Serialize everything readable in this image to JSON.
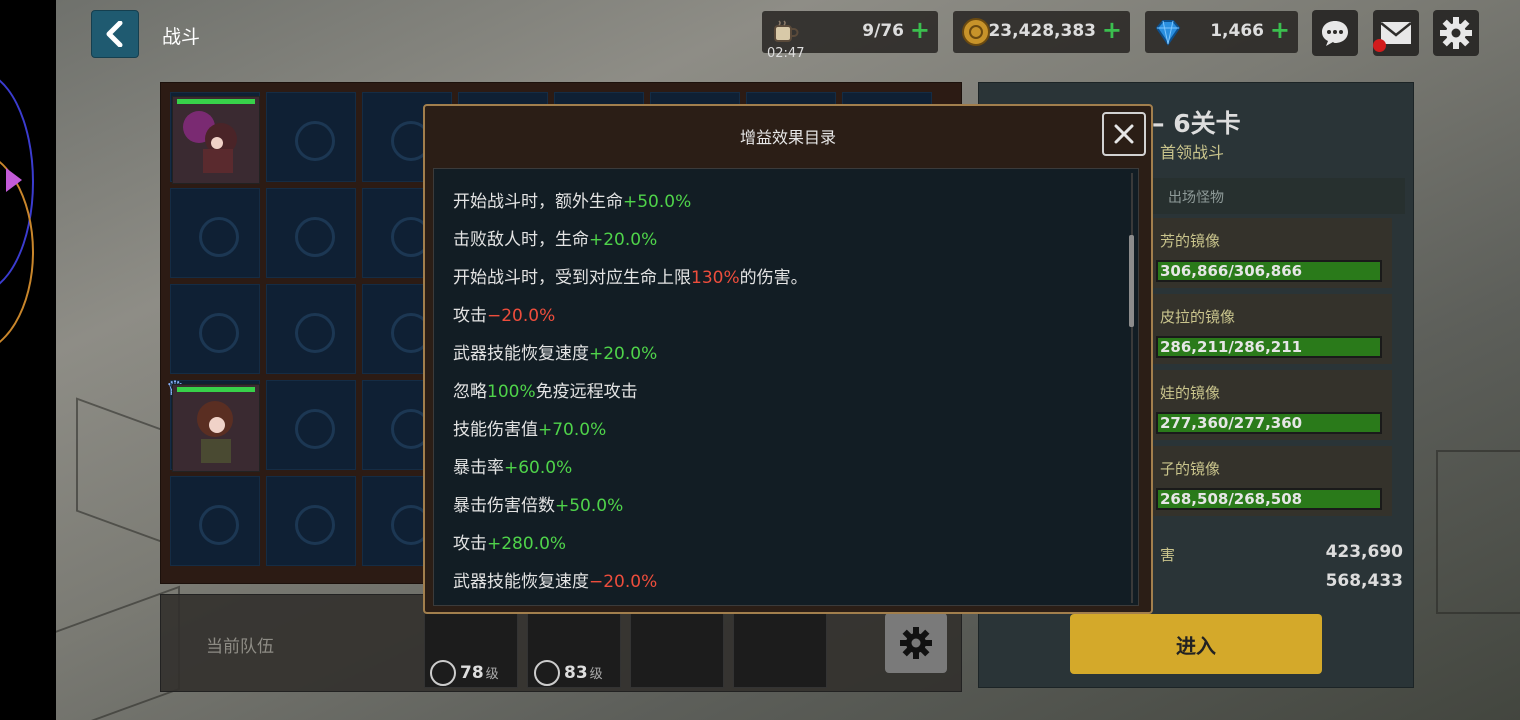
{
  "header": {
    "title": "战斗",
    "coffee": {
      "value": "9/76",
      "timer": "02:47"
    },
    "gold": {
      "value": "23,428,383"
    },
    "gems": {
      "value": "1,466"
    }
  },
  "team": {
    "label": "当前队伍",
    "members": [
      {
        "level": "78",
        "unit": "级"
      },
      {
        "level": "83",
        "unit": "级"
      }
    ]
  },
  "stage": {
    "title": "– 6关卡",
    "subtitle": "首领战斗",
    "tab_monsters": "出场怪物",
    "monsters": [
      {
        "name": "芳的镜像",
        "hp": "306,866/306,866"
      },
      {
        "name": "皮拉的镜像",
        "hp": "286,211/286,211"
      },
      {
        "name": "娃的镜像",
        "hp": "277,360/277,360"
      },
      {
        "name": "子的镜像",
        "hp": "268,508/268,508"
      }
    ],
    "damage_label": "害",
    "stat1": "423,690",
    "stat2": "568,433",
    "enter_label": "进入"
  },
  "modal": {
    "title": "增益效果目录",
    "buffs": [
      {
        "text": "开始战斗时，额外生命",
        "value": "+50.0%",
        "suffix": "",
        "kind": "pos"
      },
      {
        "text": "击败敌人时，生命",
        "value": "+20.0%",
        "suffix": "",
        "kind": "pos"
      },
      {
        "text": "开始战斗时，受到对应生命上限",
        "value": "130%",
        "suffix": "的伤害。",
        "kind": "neg"
      },
      {
        "text": "攻击",
        "value": "−20.0%",
        "suffix": "",
        "kind": "neg"
      },
      {
        "text": "武器技能恢复速度",
        "value": "+20.0%",
        "suffix": "",
        "kind": "pos"
      },
      {
        "text": "忽略",
        "value": "100%",
        "suffix": "免疫远程攻击",
        "kind": "pos"
      },
      {
        "text": "技能伤害值",
        "value": "+70.0%",
        "suffix": "",
        "kind": "pos"
      },
      {
        "text": "暴击率",
        "value": "+60.0%",
        "suffix": "",
        "kind": "pos"
      },
      {
        "text": "暴击伤害倍数",
        "value": "+50.0%",
        "suffix": "",
        "kind": "pos"
      },
      {
        "text": "攻击",
        "value": "+280.0%",
        "suffix": "",
        "kind": "pos"
      },
      {
        "text": "武器技能恢复速度",
        "value": "−20.0%",
        "suffix": "",
        "kind": "neg"
      }
    ]
  },
  "colors": {
    "positive": "#4fd34a",
    "negative": "#ed4d3c",
    "accent_gold": "#d4a92a"
  },
  "icons": [
    "back-icon",
    "coffee-icon",
    "gold-coin-icon",
    "gem-icon",
    "chat-icon",
    "mail-icon",
    "gear-icon",
    "close-icon"
  ]
}
